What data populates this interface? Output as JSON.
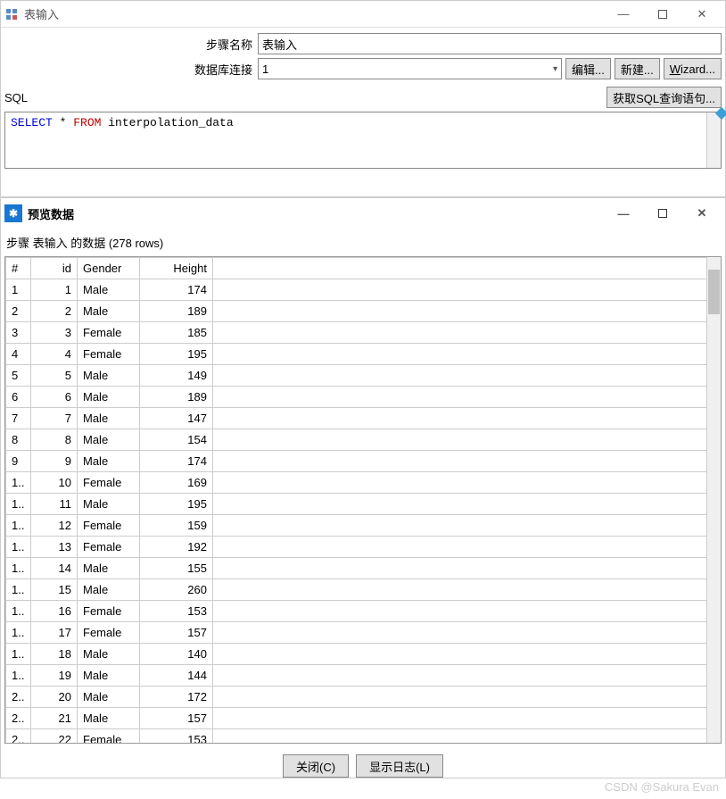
{
  "window1": {
    "title": "表输入",
    "fields": {
      "step_name_label": "步骤名称",
      "step_name_value": "表输入",
      "db_conn_label": "数据库连接",
      "db_conn_value": "1"
    },
    "buttons": {
      "edit": "编辑...",
      "new": "新建...",
      "wizard": "Wizard..."
    },
    "sql_label": "SQL",
    "get_sql_btn": "获取SQL查询语句...",
    "sql": {
      "kw1": "SELECT",
      "star": " * ",
      "kw2": "FROM",
      "rest": " interpolation_data"
    }
  },
  "window2": {
    "title": "预览数据",
    "rowcount_text": "步骤 表输入 的数据  (278 rows)",
    "headers": {
      "hash": "#",
      "id": "id",
      "gender": "Gender",
      "height": "Height"
    },
    "rows": [
      {
        "n": "1",
        "id": "1",
        "gender": "Male",
        "height": "174"
      },
      {
        "n": "2",
        "id": "2",
        "gender": "Male",
        "height": "189"
      },
      {
        "n": "3",
        "id": "3",
        "gender": "Female",
        "height": "185"
      },
      {
        "n": "4",
        "id": "4",
        "gender": "Female",
        "height": "195"
      },
      {
        "n": "5",
        "id": "5",
        "gender": "Male",
        "height": "149"
      },
      {
        "n": "6",
        "id": "6",
        "gender": "Male",
        "height": "189"
      },
      {
        "n": "7",
        "id": "7",
        "gender": "Male",
        "height": "147"
      },
      {
        "n": "8",
        "id": "8",
        "gender": "Male",
        "height": "154"
      },
      {
        "n": "9",
        "id": "9",
        "gender": "Male",
        "height": "174"
      },
      {
        "n": "1..",
        "id": "10",
        "gender": "Female",
        "height": "169"
      },
      {
        "n": "1..",
        "id": "11",
        "gender": "Male",
        "height": "195"
      },
      {
        "n": "1..",
        "id": "12",
        "gender": "Female",
        "height": "159"
      },
      {
        "n": "1..",
        "id": "13",
        "gender": "Female",
        "height": "192"
      },
      {
        "n": "1..",
        "id": "14",
        "gender": "Male",
        "height": "155"
      },
      {
        "n": "1..",
        "id": "15",
        "gender": "Male",
        "height": "260"
      },
      {
        "n": "1..",
        "id": "16",
        "gender": "Female",
        "height": "153"
      },
      {
        "n": "1..",
        "id": "17",
        "gender": "Female",
        "height": "157"
      },
      {
        "n": "1..",
        "id": "18",
        "gender": "Male",
        "height": "140"
      },
      {
        "n": "1..",
        "id": "19",
        "gender": "Male",
        "height": "144"
      },
      {
        "n": "2..",
        "id": "20",
        "gender": "Male",
        "height": "172"
      },
      {
        "n": "2..",
        "id": "21",
        "gender": "Male",
        "height": "157"
      },
      {
        "n": "2..",
        "id": "22",
        "gender": "Female",
        "height": "153"
      }
    ],
    "buttons": {
      "close": "关闭(C)",
      "showlog": "显示日志(L)"
    }
  },
  "watermark": "CSDN @Sakura Evan"
}
